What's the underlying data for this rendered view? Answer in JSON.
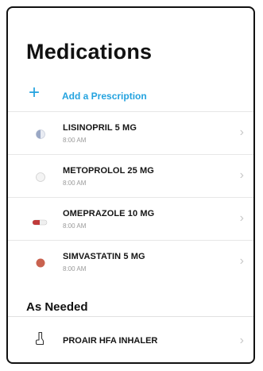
{
  "screen": {
    "title": "Medications",
    "add_prescription_label": "Add a Prescription",
    "add_icon_glyph": "+",
    "chevron_glyph": "›"
  },
  "medications": [
    {
      "name": "LISINOPRIL 5 MG",
      "time": "8:00 AM",
      "icon": "pill-half-icon",
      "color": "#9aa8c5"
    },
    {
      "name": "METOPROLOL 25 MG",
      "time": "8:00 AM",
      "icon": "pill-round-white-icon",
      "color": "#f2f2f2"
    },
    {
      "name": "OMEPRAZOLE 10 MG",
      "time": "8:00 AM",
      "icon": "capsule-icon",
      "color": "#c03a3a"
    },
    {
      "name": "SIMVASTATIN 5 MG",
      "time": "8:00 AM",
      "icon": "pill-round-brown-icon",
      "color": "#c9624f"
    }
  ],
  "as_needed": {
    "section_title": "As Needed",
    "items": [
      {
        "name": "PROAIR HFA INHALER",
        "icon": "inhaler-icon"
      }
    ]
  },
  "accent_color": "#24a3df"
}
